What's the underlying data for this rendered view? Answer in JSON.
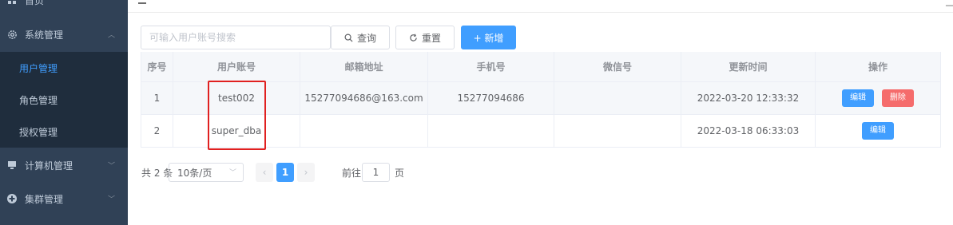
{
  "sidebar": {
    "home_label": "首页",
    "system_menu": {
      "label": "系统管理",
      "icon": "gear-icon"
    },
    "sub_items": [
      {
        "label": "用户管理",
        "active": true
      },
      {
        "label": "角色管理",
        "active": false
      },
      {
        "label": "授权管理",
        "active": false
      }
    ],
    "computer_menu": {
      "label": "计算机管理",
      "icon": "monitor-icon"
    },
    "cluster_menu": {
      "label": "集群管理",
      "icon": "plus-circle-icon"
    },
    "colors": {
      "bg": "#304156",
      "sub_bg": "#1f2d3d",
      "active": "#409eff"
    }
  },
  "toolbar": {
    "search_placeholder": "可输入用户账号搜索",
    "query_label": "查询",
    "reset_label": "重置",
    "add_label": "+ 新增"
  },
  "table": {
    "columns": [
      "序号",
      "用户账号",
      "邮箱地址",
      "手机号",
      "微信号",
      "更新时间",
      "操作"
    ],
    "rows": [
      {
        "index": "1",
        "account": "test002",
        "email": "15277094686@163.com",
        "phone": "15277094686",
        "wechat": "",
        "updated": "2022-03-20 12:33:32",
        "edit": "编辑",
        "delete": "删除"
      },
      {
        "index": "2",
        "account": "super_dba",
        "email": "",
        "phone": "",
        "wechat": "",
        "updated": "2022-03-18 06:33:03",
        "edit": "编辑"
      }
    ]
  },
  "pagination": {
    "total_text": "共 2 条",
    "page_size": "10条/页",
    "current_page": "1",
    "goto_label": "前往",
    "goto_value": "1",
    "page_suffix": "页"
  },
  "accent_color": "#409eff",
  "danger_color": "#f56c6c"
}
